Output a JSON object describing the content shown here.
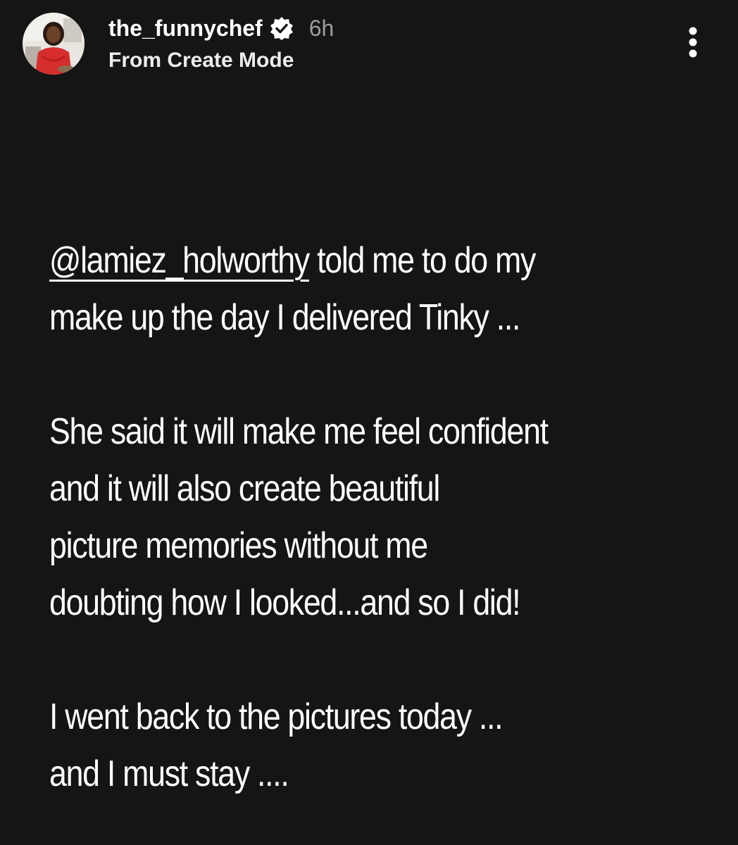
{
  "header": {
    "username": "the_funnychef",
    "timestamp": "6h",
    "subtitle": "From Create Mode",
    "more_icon": "more-vertical-icon",
    "verified_icon": "verified-badge-icon"
  },
  "colors": {
    "background": "#151515",
    "text": "#ffffff",
    "muted": "#9e9e9e",
    "avatar_accent": "#d62d2d"
  },
  "story_text": {
    "paragraph_1": {
      "mention": "@lamiez_holworthy",
      "line_1_rest": " told me to do my",
      "line_2": "make up the day I delivered Tinky ..."
    },
    "paragraph_2": {
      "line_1": "She said it will make me feel confident",
      "line_2": "and it will also create beautiful",
      "line_3": "picture memories without me",
      "line_4": "doubting how I looked...and so I did!"
    },
    "paragraph_3": {
      "line_1": "I went back to the pictures today ...",
      "line_2": "and I must stay ...."
    }
  }
}
